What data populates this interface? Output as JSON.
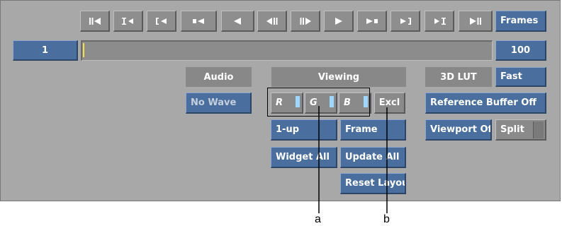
{
  "transport": {
    "buttons": [
      {
        "name": "go-to-start-button",
        "icon": "skip-to-start-icon"
      },
      {
        "name": "go-to-in-point-button",
        "icon": "go-to-in-icon"
      },
      {
        "name": "go-to-previous-mark-button",
        "icon": "previous-mark-icon"
      },
      {
        "name": "jump-back-button",
        "icon": "jump-back-icon"
      },
      {
        "name": "play-reverse-button",
        "icon": "play-reverse-icon"
      },
      {
        "name": "step-back-button",
        "icon": "step-back-icon"
      },
      {
        "name": "step-forward-button",
        "icon": "step-forward-icon"
      },
      {
        "name": "play-button",
        "icon": "play-icon"
      },
      {
        "name": "jump-forward-button",
        "icon": "jump-forward-icon"
      },
      {
        "name": "go-to-next-mark-button",
        "icon": "next-mark-icon"
      },
      {
        "name": "go-to-out-point-button",
        "icon": "go-to-out-icon"
      },
      {
        "name": "go-to-end-button",
        "icon": "skip-to-end-icon"
      }
    ],
    "frames_label": "Frames"
  },
  "timeline": {
    "current_frame": "1",
    "end_frame": "100",
    "position_fraction": 0.0
  },
  "audio": {
    "label": "Audio",
    "wave_button": "No Wave"
  },
  "viewing": {
    "label": "Viewing",
    "channels": [
      "R",
      "G",
      "B"
    ],
    "excl_button": "Excl",
    "layout_button": "1-up",
    "frame_button": "Frame",
    "widget_button": "Widget All",
    "update_button": "Update All",
    "reset_button": "Reset Layout"
  },
  "lut": {
    "label": "3D LUT",
    "mode_button": "Fast",
    "reference_button": "Reference Buffer Off",
    "viewport_button": "Viewport Off",
    "split_button": "Split"
  },
  "callouts": {
    "a": "a",
    "b": "b"
  },
  "colors": {
    "panel": "#a8a8a8",
    "blue_button": "#4a6e9e",
    "grey_button": "#8a8a8a",
    "channel_indicator": "#9cd8ff",
    "timeline_marker": "#f2e04a"
  }
}
